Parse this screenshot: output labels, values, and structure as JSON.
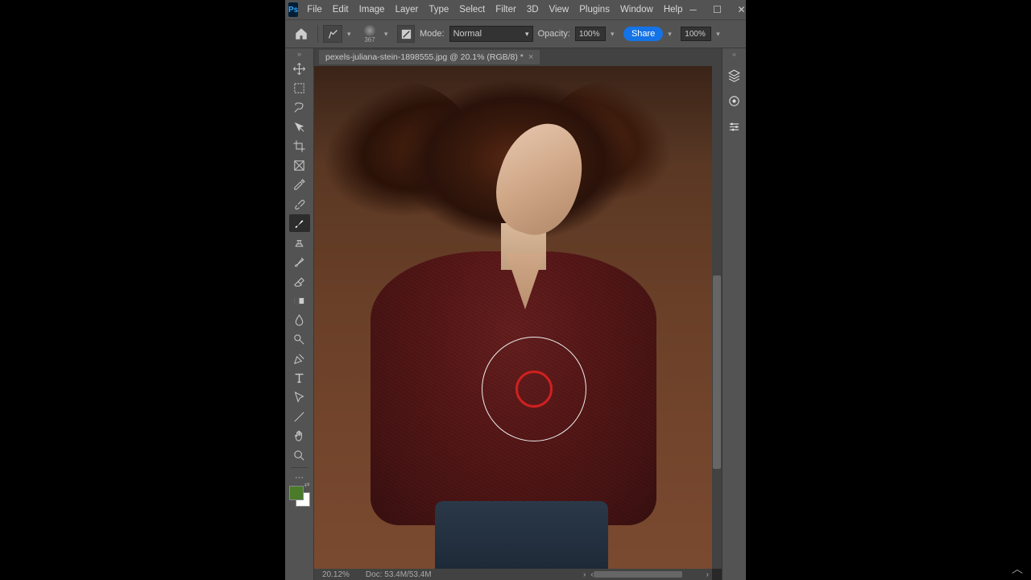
{
  "app": {
    "logo": "Ps"
  },
  "menu": {
    "file": "File",
    "edit": "Edit",
    "image": "Image",
    "layer": "Layer",
    "type": "Type",
    "select": "Select",
    "filter": "Filter",
    "threeD": "3D",
    "view": "View",
    "plugins": "Plugins",
    "window": "Window",
    "help": "Help"
  },
  "options": {
    "brush_size": "367",
    "mode_label": "Mode:",
    "mode_value": "Normal",
    "opacity_label": "Opacity:",
    "opacity_value": "100%",
    "flow_value": "100%",
    "share": "Share"
  },
  "document": {
    "tab_title": "pexels-juliana-stein-1898555.jpg @ 20.1% (RGB/8) *",
    "zoom": "20.12%",
    "docinfo": "Doc: 53.4M/53.4M"
  },
  "colors": {
    "foreground": "#4a7a2a",
    "background": "#ffffff",
    "accent": "#1473e6"
  },
  "tools": {
    "move": "move-tool",
    "marquee": "marquee-tool",
    "lasso": "lasso-tool",
    "wand": "object-select-tool",
    "crop": "crop-tool",
    "frame": "frame-tool",
    "eyedropper": "eyedropper-tool",
    "healing": "spot-heal-tool",
    "brush": "brush-tool",
    "stamp": "clone-stamp-tool",
    "history": "history-brush-tool",
    "eraser": "eraser-tool",
    "gradient": "gradient-tool",
    "blur": "blur-tool",
    "dodge": "dodge-tool",
    "pen": "pen-tool",
    "type": "type-tool",
    "path": "path-select-tool",
    "line": "line-tool",
    "hand": "hand-tool",
    "zoom": "zoom-tool"
  },
  "panels": {
    "layers": "layers-panel",
    "channels": "channels-panel",
    "adjustments": "adjustments-panel"
  }
}
